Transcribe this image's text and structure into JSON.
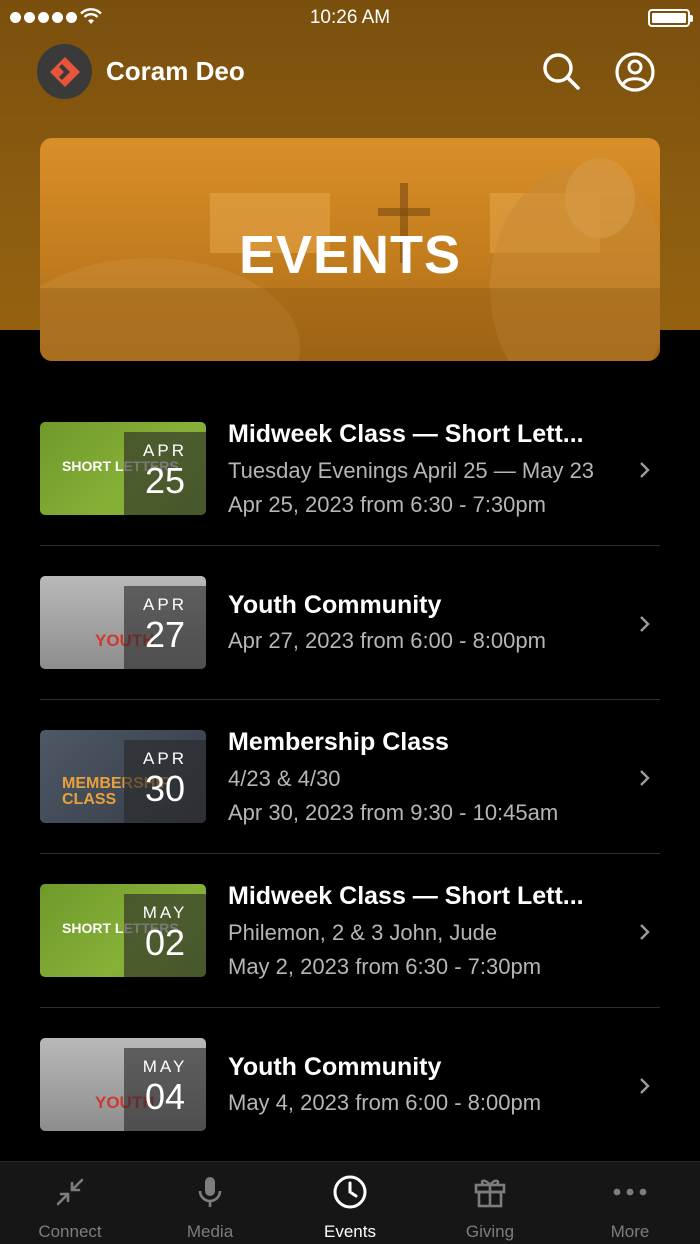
{
  "status_bar": {
    "time": "10:26 AM"
  },
  "app": {
    "title": "Coram Deo"
  },
  "hero": {
    "title": "EVENTS"
  },
  "events": [
    {
      "month": "APR",
      "day": "25",
      "thumb_text": "SHORT LETTERS",
      "title": "Midweek Class — Short Lett...",
      "subtitle": "Tuesday Evenings April 25 — May 23",
      "datetime": "Apr 25, 2023 from 6:30 - 7:30pm"
    },
    {
      "month": "APR",
      "day": "27",
      "thumb_text": "YOUTH",
      "title": "Youth Community",
      "datetime": "Apr 27, 2023 from 6:00 - 8:00pm"
    },
    {
      "month": "APR",
      "day": "30",
      "thumb_text": "MEMBERSHIP CLASS",
      "title": "Membership Class",
      "subtitle": "4/23 & 4/30",
      "datetime": "Apr 30, 2023 from 9:30 - 10:45am"
    },
    {
      "month": "MAY",
      "day": "02",
      "thumb_text": "SHORT LETTERS",
      "title": "Midweek Class — Short Lett...",
      "subtitle": "Philemon, 2 & 3 John, Jude",
      "datetime": "May 2, 2023 from 6:30 - 7:30pm"
    },
    {
      "month": "MAY",
      "day": "04",
      "thumb_text": "YOUTH",
      "title": "Youth Community",
      "datetime": "May 4, 2023 from 6:00 - 8:00pm"
    }
  ],
  "tabs": [
    {
      "label": "Connect",
      "icon": "arrows-in-icon"
    },
    {
      "label": "Media",
      "icon": "microphone-icon"
    },
    {
      "label": "Events",
      "icon": "clock-icon",
      "active": true
    },
    {
      "label": "Giving",
      "icon": "gift-icon"
    },
    {
      "label": "More",
      "icon": "ellipsis-icon"
    }
  ],
  "colors": {
    "header": "#8c5c10",
    "hero": "#d98f2a",
    "background": "#000000",
    "tab_active": "#ffffff",
    "tab_inactive": "#7d7d7d"
  }
}
